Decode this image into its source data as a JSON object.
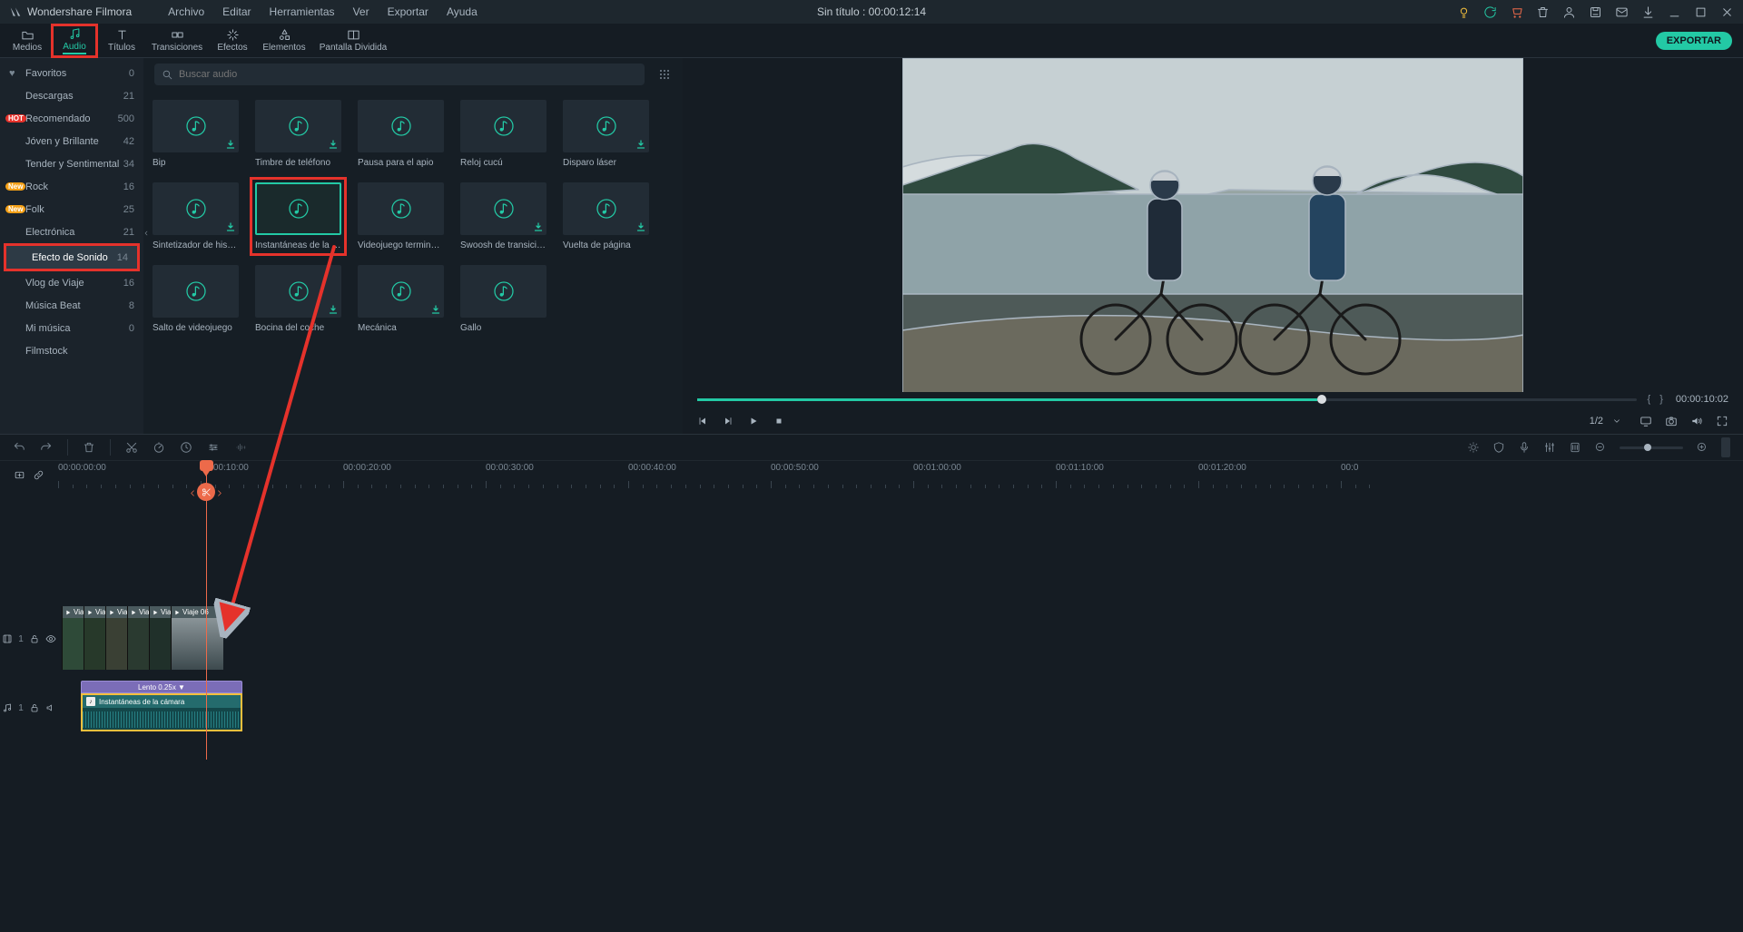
{
  "app_name": "Wondershare Filmora",
  "doc_title": "Sin título : 00:00:12:14",
  "menus": [
    "Archivo",
    "Editar",
    "Herramientas",
    "Ver",
    "Exportar",
    "Ayuda"
  ],
  "tabs": [
    {
      "label": "Medios"
    },
    {
      "label": "Audio"
    },
    {
      "label": "Títulos"
    },
    {
      "label": "Transiciones"
    },
    {
      "label": "Efectos"
    },
    {
      "label": "Elementos"
    },
    {
      "label": "Pantalla Dividida"
    }
  ],
  "export_label": "EXPORTAR",
  "sidebar": [
    {
      "label": "Favoritos",
      "count": "0",
      "heart": true
    },
    {
      "label": "Descargas",
      "count": "21"
    },
    {
      "label": "Recomendado",
      "count": "500",
      "tag": "HOT"
    },
    {
      "label": "Jóven y Brillante",
      "count": "42"
    },
    {
      "label": "Tender y Sentimental",
      "count": "34"
    },
    {
      "label": "Rock",
      "count": "16",
      "tag": "New"
    },
    {
      "label": "Folk",
      "count": "25",
      "tag": "New"
    },
    {
      "label": "Electrónica",
      "count": "21"
    },
    {
      "label": "Efecto de Sonido",
      "count": "14",
      "selected": true,
      "highlight": true
    },
    {
      "label": "Vlog de Viaje",
      "count": "16"
    },
    {
      "label": "Música Beat",
      "count": "8"
    },
    {
      "label": "Mi música",
      "count": "0"
    },
    {
      "label": "Filmstock",
      "count": ""
    }
  ],
  "search_placeholder": "Buscar audio",
  "audio_items": [
    {
      "label": "Bip",
      "dl": true
    },
    {
      "label": "Timbre de teléfono",
      "dl": true
    },
    {
      "label": "Pausa para el apio"
    },
    {
      "label": "Reloj cucú"
    },
    {
      "label": "Disparo láser",
      "dl": true
    },
    {
      "label": "Sintetizador de histor…",
      "dl": true
    },
    {
      "label": "Instantáneas de la cá…",
      "selected": true,
      "redbox": true
    },
    {
      "label": "Videojuego terminado"
    },
    {
      "label": "Swoosh de transición",
      "dl": true
    },
    {
      "label": "Vuelta de página",
      "dl": true
    },
    {
      "label": "Salto de videojuego"
    },
    {
      "label": "Bocina del coche",
      "dl": true
    },
    {
      "label": "Mecánica",
      "dl": true
    },
    {
      "label": "Gallo"
    }
  ],
  "preview": {
    "time": "00:00:10:02",
    "page": "1/2"
  },
  "timeline": {
    "ruler": [
      "00:00:00:00",
      "00:00:10:00",
      "00:00:20:00",
      "00:00:30:00",
      "00:00:40:00",
      "00:00:50:00",
      "00:01:00:00",
      "00:01:10:00",
      "00:01:20:00",
      "00:0"
    ],
    "clip_label_prefix": "Viaje",
    "last_clip_label": "Viaje 06",
    "speed_label": "Lento 0.25x ▼",
    "audio_clip_label": "Instantáneas de la cámara",
    "video_track": "1",
    "audio_track": "1"
  }
}
